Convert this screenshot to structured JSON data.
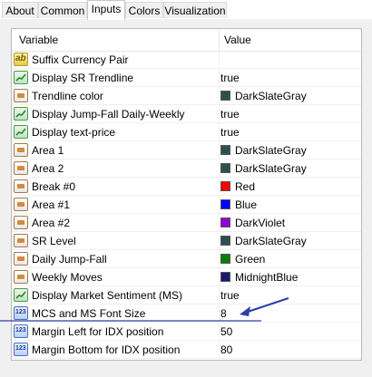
{
  "tabs": [
    "About",
    "Common",
    "Inputs",
    "Colors",
    "Visualization"
  ],
  "active_tab": "Inputs",
  "grid": {
    "col_variable": "Variable",
    "col_value": "Value"
  },
  "rows": [
    {
      "name": "Suffix Currency Pair",
      "value": "",
      "icon": "string-icon",
      "color": null
    },
    {
      "name": "Display SR Trendline",
      "value": "true",
      "icon": "bool-icon",
      "color": null
    },
    {
      "name": "Trendline color",
      "value": "DarkSlateGray",
      "icon": "color-icon",
      "color": "#2f4f4f"
    },
    {
      "name": "Display Jump-Fall Daily-Weekly",
      "value": "true",
      "icon": "bool-icon",
      "color": null
    },
    {
      "name": "Display text-price",
      "value": "true",
      "icon": "bool-icon",
      "color": null
    },
    {
      "name": "Area 1",
      "value": "DarkSlateGray",
      "icon": "color-icon",
      "color": "#2f4f4f"
    },
    {
      "name": "Area 2",
      "value": "DarkSlateGray",
      "icon": "color-icon",
      "color": "#2f4f4f"
    },
    {
      "name": "Break #0",
      "value": "Red",
      "icon": "color-icon",
      "color": "#ff0000"
    },
    {
      "name": "Area #1",
      "value": "Blue",
      "icon": "color-icon",
      "color": "#0000ff"
    },
    {
      "name": "Area #2",
      "value": "DarkViolet",
      "icon": "color-icon",
      "color": "#9400d3"
    },
    {
      "name": "SR Level",
      "value": "DarkSlateGray",
      "icon": "color-icon",
      "color": "#2f4f4f"
    },
    {
      "name": "Daily Jump-Fall",
      "value": "Green",
      "icon": "color-icon",
      "color": "#008000"
    },
    {
      "name": "Weekly Moves",
      "value": "MidnightBlue",
      "icon": "color-icon",
      "color": "#191970"
    },
    {
      "name": "Display Market Sentiment (MS)",
      "value": "true",
      "icon": "bool-icon",
      "color": null
    },
    {
      "name": "MCS and MS Font Size",
      "value": "8",
      "icon": "int-icon",
      "color": null
    },
    {
      "name": "Margin Left for IDX position",
      "value": "50",
      "icon": "int-icon",
      "color": null
    },
    {
      "name": "Margin Bottom for IDX position",
      "value": "80",
      "icon": "int-icon",
      "color": null
    }
  ],
  "annotation_color": "#2a3fa8"
}
